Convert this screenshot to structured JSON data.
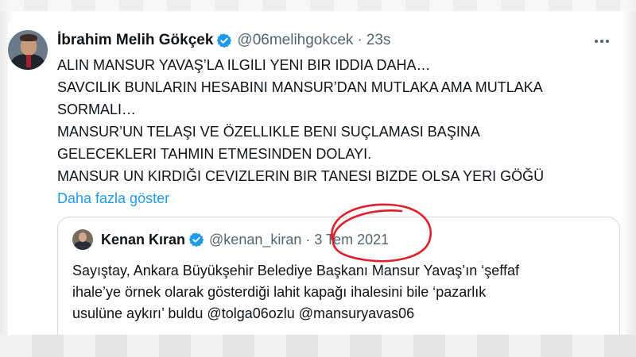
{
  "tweet": {
    "author_name": "İbrahim Melih Gökçek",
    "author_handle": "@06melihgokcek",
    "separator": "·",
    "time": "23s",
    "lines": [
      "ALIN MANSUR YAVAŞ’LA ILGILI YENI BIR IDDIA DAHA…",
      "SAVCILIK BUNLARIN HESABINI MANSUR’DAN MUTLAKA AMA MUTLAKA",
      "SORMALI…",
      "MANSUR’UN TELAŞI VE ÖZELLIKLE BENI SUÇLAMASI BAŞINA",
      "GELECEKLERI TAHMIN ETMESINDEN DOLAYI.",
      "MANSUR UN KIRDIĞI CEVIZLERIN BIR TANESI BIZDE OLSA YERI GÖĞÜ"
    ],
    "show_more": "Daha fazla göster",
    "more_icon": "more-horizontal-icon",
    "verified_color": "#1d9bf0"
  },
  "quote": {
    "author_name": "Kenan Kıran",
    "author_handle": "@kenan_kiran",
    "separator": "·",
    "date": "3 Tem 2021",
    "lines": [
      "Sayıştay, Ankara Büyükşehir Belediye Başkanı Mansur Yavaş’ın ‘şeffaf",
      "ihale’ye örnek olarak gösterdiği lahit kapağı ihalesini bile ‘pazarlık",
      "usulüne aykırı’ buldu @tolga06ozlu @mansuryavas06"
    ]
  },
  "annotation": {
    "color": "#e0202a"
  }
}
